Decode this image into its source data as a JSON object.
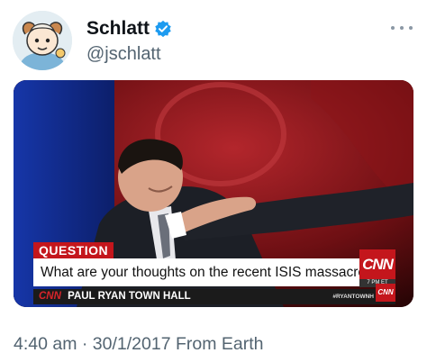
{
  "author": {
    "display_name": "Schlatt",
    "handle": "@jschlatt",
    "verified": true,
    "avatar_icon": "cartoon-ram-avatar"
  },
  "menu": {
    "icon": "more-horizontal-icon"
  },
  "media": {
    "question_tag": "QUESTION",
    "question_text": "What are your thoughts on the recent ISIS massacre?",
    "network_logo": "CNN",
    "time_tag": "7 PM ET",
    "ticker_network": "CNN",
    "ticker_show": "PAUL RYAN TOWN HALL",
    "ticker_hashtag": "#RYANTOWNH",
    "ticker_logo": "CNN"
  },
  "meta": {
    "timestamp": "4:40 am · 30/1/2017 From Earth"
  },
  "colors": {
    "verified_blue": "#1d9bf0",
    "secondary_text": "#536471",
    "cnn_red": "#c4161c"
  }
}
